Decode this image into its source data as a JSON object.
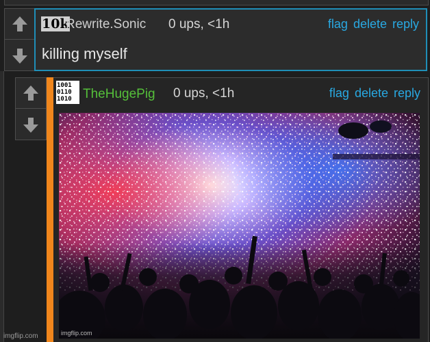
{
  "comment1": {
    "badge": "10k",
    "username": "Rewrite.Sonic",
    "meta": "0 ups, <1h",
    "actions": [
      "flag",
      "delete",
      "reply"
    ],
    "body": "killing myself"
  },
  "comment2": {
    "badge_rows": [
      "1001",
      "0110",
      "1010"
    ],
    "username": "TheHugePig",
    "meta": "0 ups, <1h",
    "actions": [
      "flag",
      "delete",
      "reply"
    ]
  },
  "watermarks": {
    "page": "imgflip.com",
    "image": "imgflip.com"
  },
  "colors": {
    "link": "#29a9e2",
    "reply_accent": "#f0861c",
    "selected_border": "#1f8fb8",
    "username_green": "#55c03a"
  }
}
